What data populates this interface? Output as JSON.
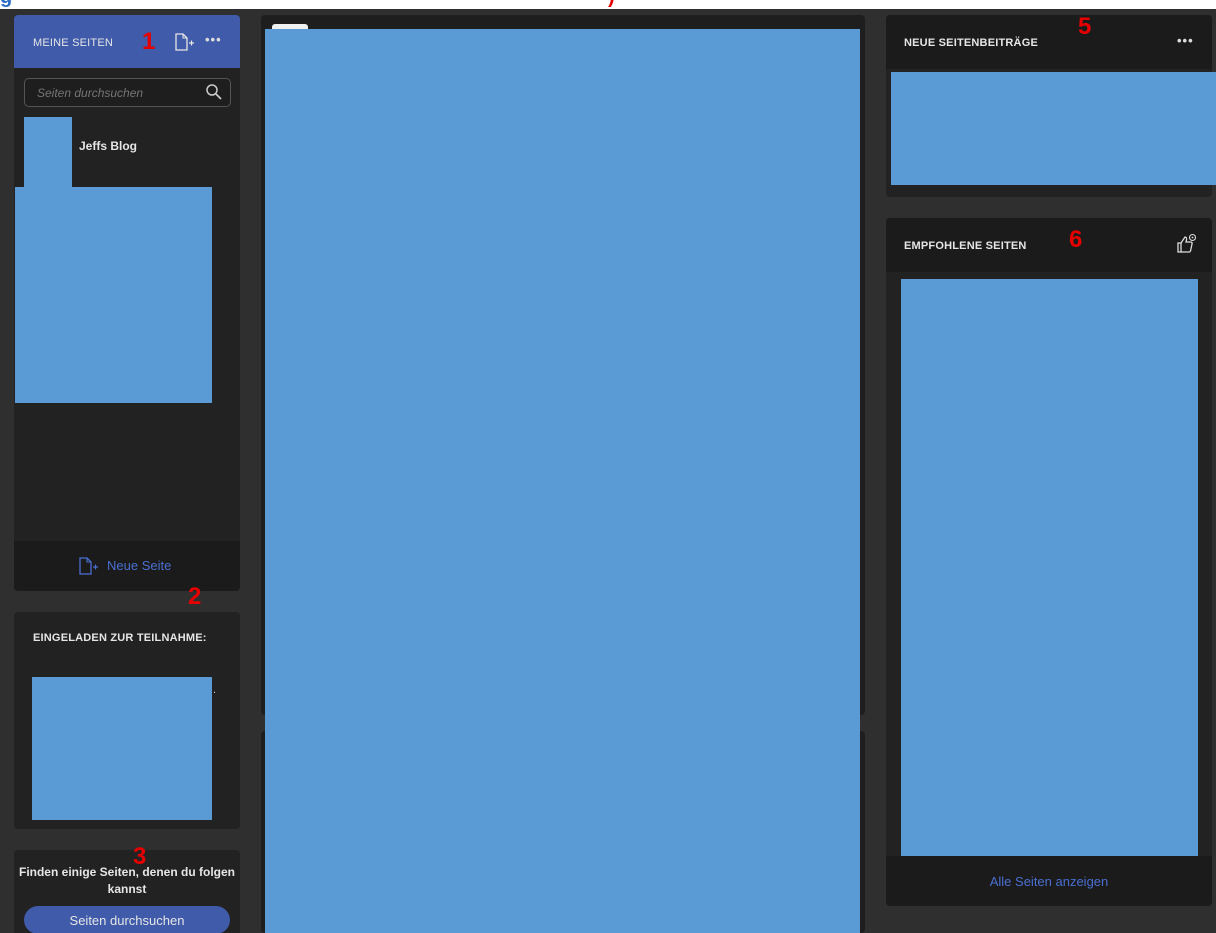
{
  "top_heading": {
    "left_text": "g",
    "right_text": ")"
  },
  "my_pages": {
    "title": "MEINE SEITEN",
    "marker": "1",
    "search_placeholder": "Seiten durchsuchen",
    "items": [
      {
        "label": "Jeffs Blog"
      }
    ],
    "new_page_label": "Neue Seite",
    "more_label": "•••",
    "new_page_icon": "new-page-icon"
  },
  "markers": {
    "two": "2",
    "three": "3",
    "five": "5",
    "six": "6"
  },
  "invited": {
    "title": "EINGELADEN ZUR TEILNAHME:",
    "truncation": ".."
  },
  "find_pages": {
    "text": "Finden einige Seiten, denen du folgen kannst",
    "button_label": "Seiten durchsuchen"
  },
  "new_posts": {
    "title": "NEUE SEITENBEITRÄGE",
    "more_label": "•••"
  },
  "recommended": {
    "title": "EMPFOHLENE SEITEN",
    "show_all_label": "Alle Seiten anzeigen",
    "icon": "thumbs-up-settings-icon"
  },
  "colors": {
    "background": "#2f2f2f",
    "panel": "#222222",
    "header_blue": "#3f5ba9",
    "link_blue": "#4a6fd1",
    "redaction": "#5b9bd5",
    "marker_red": "#e60000"
  }
}
